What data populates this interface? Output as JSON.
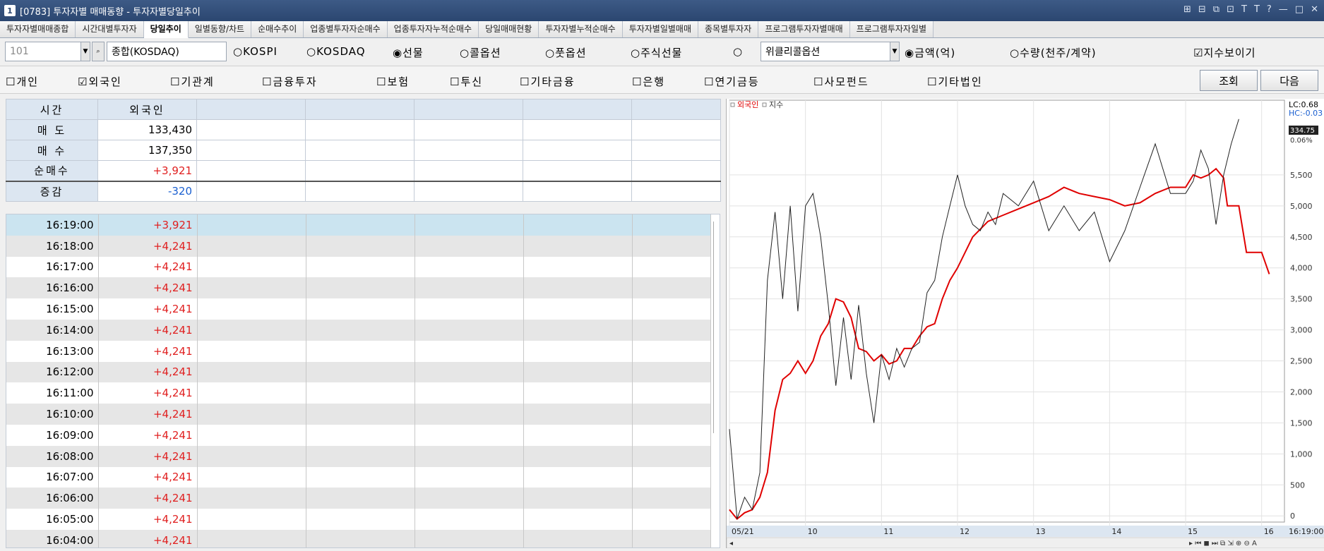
{
  "window": {
    "title": "[0783] 투자자별 매매동향 - 투자자별당일추이",
    "icon_label": "1",
    "controls": [
      "⊞",
      "⊟",
      "⧉",
      "⊡",
      "T",
      "T",
      "?",
      "—",
      "□",
      "✕"
    ]
  },
  "tabs": [
    {
      "label": "투자자별매매종합",
      "active": false
    },
    {
      "label": "시간대별투자자",
      "active": false
    },
    {
      "label": "당일추이",
      "active": true
    },
    {
      "label": "일별동향/차트",
      "active": false
    },
    {
      "label": "순매수추이",
      "active": false
    },
    {
      "label": "업종별투자자순매수",
      "active": false
    },
    {
      "label": "업종투자자누적순매수",
      "active": false
    },
    {
      "label": "당일매매현황",
      "active": false
    },
    {
      "label": "투자자별누적순매수",
      "active": false
    },
    {
      "label": "투자자별일별매매",
      "active": false
    },
    {
      "label": "종목별투자자",
      "active": false
    },
    {
      "label": "프로그램투자자별매매",
      "active": false
    },
    {
      "label": "프로그램투자자일별",
      "active": false
    }
  ],
  "filters": {
    "code_value": "101",
    "market_value": "종합(KOSDAQ)",
    "market_radios": [
      {
        "label": "KOSPI",
        "selected": false
      },
      {
        "label": "KOSDAQ",
        "selected": false
      },
      {
        "label": "선물",
        "selected": true
      },
      {
        "label": "콜옵션",
        "selected": false
      },
      {
        "label": "풋옵션",
        "selected": false
      },
      {
        "label": "주식선물",
        "selected": false
      },
      {
        "label": "",
        "selected": false
      }
    ],
    "weekly_select_value": "위클리콜옵션",
    "unit_radios": [
      {
        "label": "금액(억)",
        "selected": true
      },
      {
        "label": "수량(천주/계약)",
        "selected": false
      }
    ],
    "show_index_label": "지수보이기",
    "show_index_checked": true
  },
  "investors": [
    {
      "label": "개인",
      "checked": false
    },
    {
      "label": "외국인",
      "checked": true
    },
    {
      "label": "기관계",
      "checked": false
    },
    {
      "label": "금융투자",
      "checked": false
    },
    {
      "label": "보험",
      "checked": false
    },
    {
      "label": "투신",
      "checked": false
    },
    {
      "label": "기타금융",
      "checked": false
    },
    {
      "label": "은행",
      "checked": false
    },
    {
      "label": "연기금등",
      "checked": false
    },
    {
      "label": "사모펀드",
      "checked": false
    },
    {
      "label": "기타법인",
      "checked": false
    }
  ],
  "buttons": {
    "query": "조회",
    "next": "다음"
  },
  "summary": {
    "header": {
      "time": "시간",
      "investor": "외국인"
    },
    "rows": [
      {
        "label": "매 도",
        "value": "133,430",
        "tone": "plain"
      },
      {
        "label": "매 수",
        "value": "137,350",
        "tone": "plain"
      },
      {
        "label": "순매수",
        "value": "+3,921",
        "tone": "pos"
      },
      {
        "label": "증감",
        "value": "-320",
        "tone": "neg"
      }
    ]
  },
  "time_rows": [
    {
      "time": "16:19:00",
      "value": "+3,921"
    },
    {
      "time": "16:18:00",
      "value": "+4,241"
    },
    {
      "time": "16:17:00",
      "value": "+4,241"
    },
    {
      "time": "16:16:00",
      "value": "+4,241"
    },
    {
      "time": "16:15:00",
      "value": "+4,241"
    },
    {
      "time": "16:14:00",
      "value": "+4,241"
    },
    {
      "time": "16:13:00",
      "value": "+4,241"
    },
    {
      "time": "16:12:00",
      "value": "+4,241"
    },
    {
      "time": "16:11:00",
      "value": "+4,241"
    },
    {
      "time": "16:10:00",
      "value": "+4,241"
    },
    {
      "time": "16:09:00",
      "value": "+4,241"
    },
    {
      "time": "16:08:00",
      "value": "+4,241"
    },
    {
      "time": "16:07:00",
      "value": "+4,241"
    },
    {
      "time": "16:06:00",
      "value": "+4,241"
    },
    {
      "time": "16:05:00",
      "value": "+4,241"
    },
    {
      "time": "16:04:00",
      "value": "+4,241"
    }
  ],
  "chart_data": {
    "type": "line",
    "legend": [
      "외국인",
      "지수"
    ],
    "colors": {
      "외국인": "#e00000",
      "지수": "#222222"
    },
    "top_right_labels": {
      "lc": "LC:0.68",
      "hc": "HC:-0.03",
      "index_value": "334.75",
      "index_pct": "0.06%"
    },
    "y_ticks": [
      0,
      500,
      1000,
      1500,
      2000,
      2500,
      3000,
      3500,
      4000,
      4500,
      5000,
      5500
    ],
    "y_tick_labels": [
      "0",
      "500",
      "1,000",
      "1,500",
      "2,000",
      "2,500",
      "3,000",
      "3,500",
      "4,000",
      "4,500",
      "5,000",
      "5,500"
    ],
    "ylim": [
      -100,
      6500
    ],
    "x_labels": [
      {
        "label": "05/21",
        "x": 0
      },
      {
        "label": "10",
        "x": 100
      },
      {
        "label": "11",
        "x": 200
      },
      {
        "label": "12",
        "x": 300
      },
      {
        "label": "13",
        "x": 400
      },
      {
        "label": "14",
        "x": 500
      },
      {
        "label": "15",
        "x": 600
      },
      {
        "label": "16",
        "x": 700
      }
    ],
    "xlim": [
      0,
      730
    ],
    "x_end_label": "16:19:00",
    "series": [
      {
        "name": "외국인",
        "x": [
          0,
          10,
          20,
          30,
          40,
          50,
          60,
          70,
          80,
          90,
          100,
          110,
          120,
          130,
          140,
          150,
          160,
          170,
          180,
          190,
          200,
          210,
          220,
          230,
          240,
          250,
          260,
          270,
          280,
          290,
          300,
          320,
          340,
          360,
          380,
          400,
          420,
          440,
          460,
          480,
          500,
          520,
          540,
          560,
          580,
          600,
          610,
          620,
          630,
          640,
          650,
          655,
          660,
          670,
          680,
          690,
          700,
          710
        ],
        "y": [
          100,
          -50,
          50,
          100,
          300,
          700,
          1700,
          2200,
          2300,
          2500,
          2300,
          2500,
          2900,
          3100,
          3500,
          3450,
          3200,
          2700,
          2650,
          2500,
          2600,
          2450,
          2500,
          2700,
          2700,
          2900,
          3050,
          3100,
          3500,
          3800,
          4000,
          4500,
          4750,
          4850,
          4950,
          5050,
          5150,
          5300,
          5200,
          5150,
          5100,
          5000,
          5050,
          5200,
          5300,
          5300,
          5500,
          5450,
          5500,
          5600,
          5450,
          5000,
          5000,
          5000,
          4250,
          4250,
          4250,
          3900
        ]
      },
      {
        "name": "지수",
        "x": [
          0,
          10,
          20,
          30,
          40,
          50,
          60,
          70,
          80,
          90,
          100,
          110,
          120,
          130,
          140,
          150,
          160,
          170,
          180,
          190,
          200,
          210,
          220,
          230,
          240,
          250,
          260,
          270,
          280,
          290,
          300,
          310,
          320,
          330,
          340,
          350,
          360,
          380,
          400,
          420,
          440,
          460,
          480,
          500,
          520,
          540,
          560,
          580,
          600,
          610,
          620,
          630,
          640,
          650,
          660,
          670
        ],
        "y": [
          1400,
          -50,
          300,
          100,
          700,
          3800,
          4900,
          3500,
          5000,
          3300,
          5000,
          5200,
          4500,
          3400,
          2100,
          3200,
          2200,
          3400,
          2300,
          1500,
          2600,
          2200,
          2700,
          2400,
          2700,
          2800,
          3600,
          3800,
          4500,
          5000,
          5500,
          5000,
          4700,
          4600,
          4900,
          4700,
          5200,
          5000,
          5400,
          4600,
          5000,
          4600,
          4900,
          4100,
          4600,
          5300,
          6000,
          5200,
          5200,
          5400,
          5900,
          5600,
          4700,
          5500,
          6000,
          6400
        ]
      }
    ]
  }
}
